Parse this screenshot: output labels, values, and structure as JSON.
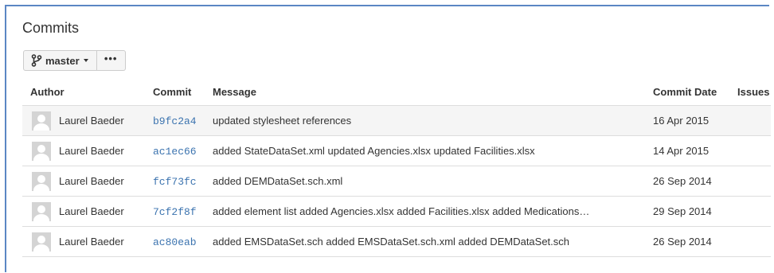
{
  "page": {
    "title": "Commits"
  },
  "toolbar": {
    "branch_label": "master",
    "more_label": "•••"
  },
  "table": {
    "headers": {
      "author": "Author",
      "commit": "Commit",
      "message": "Message",
      "date": "Commit Date",
      "issues": "Issues"
    },
    "rows": [
      {
        "author": "Laurel Baeder",
        "commit": "b9fc2a4",
        "message": "updated stylesheet references",
        "date": "16 Apr 2015",
        "issues": ""
      },
      {
        "author": "Laurel Baeder",
        "commit": "ac1ec66",
        "message": "added StateDataSet.xml updated Agencies.xlsx updated Facilities.xlsx",
        "date": "14 Apr 2015",
        "issues": ""
      },
      {
        "author": "Laurel Baeder",
        "commit": "fcf73fc",
        "message": "added DEMDataSet.sch.xml",
        "date": "26 Sep 2014",
        "issues": ""
      },
      {
        "author": "Laurel Baeder",
        "commit": "7cf2f8f",
        "message": "added element list added Agencies.xlsx added Facilities.xlsx added Medications…",
        "date": "29 Sep 2014",
        "issues": ""
      },
      {
        "author": "Laurel Baeder",
        "commit": "ac80eab",
        "message": "added EMSDataSet.sch added EMSDataSet.sch.xml added DEMDataSet.sch",
        "date": "26 Sep 2014",
        "issues": ""
      }
    ]
  },
  "colors": {
    "link": "#3b73af",
    "frame_border": "#5b87c4",
    "highlight_row": "#f5f5f5"
  },
  "icons": {
    "branch": "branch-icon",
    "more": "more-icon",
    "avatar": "default-avatar-icon",
    "caret": "chevron-down-icon"
  }
}
